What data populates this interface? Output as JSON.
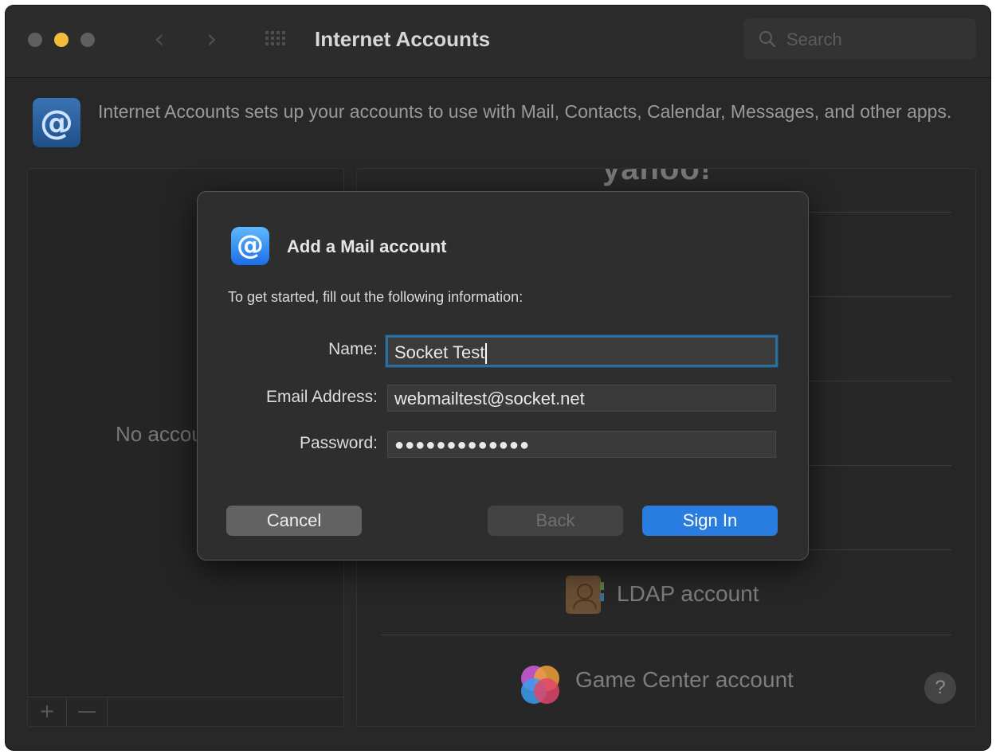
{
  "window": {
    "title": "Internet Accounts",
    "search_placeholder": "Search"
  },
  "header": {
    "icon_symbol": "@",
    "description": "Internet Accounts sets up your accounts to use with Mail, Contacts, Calendar, Messages, and other apps."
  },
  "accounts_list": {
    "empty_text": "No accounts",
    "add_label": "+",
    "remove_label": "—"
  },
  "providers": {
    "yahoo_logo": "yahoo!",
    "ldap_label": "LDAP account",
    "game_center_label": "Game Center account",
    "help_label": "?"
  },
  "dialog": {
    "icon_symbol": "@",
    "title": "Add a Mail account",
    "subtitle": "To get started, fill out the following information:",
    "name_label": "Name:",
    "name_value": "Socket Test",
    "email_label": "Email Address:",
    "email_value": "webmailtest@socket.net",
    "password_label": "Password:",
    "password_value": "●●●●●●●●●●●●●",
    "cancel_label": "Cancel",
    "back_label": "Back",
    "sign_in_label": "Sign In"
  },
  "colors": {
    "accent": "#2a7de0",
    "traffic_light_min": "#f5bb3a",
    "focus_ring": "#2f6e9a"
  }
}
